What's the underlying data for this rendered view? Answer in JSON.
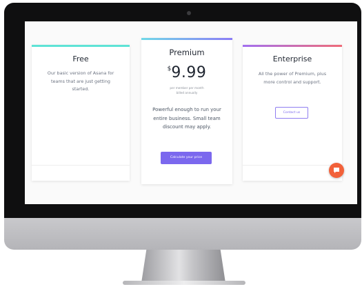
{
  "pricing": {
    "free": {
      "title": "Free",
      "description": "Our basic version of Asana for teams that are just getting started."
    },
    "premium": {
      "title": "Premium",
      "currency": "$",
      "price": "9.99",
      "note_line1": "per member per month",
      "note_line2": "billed annually",
      "description": "Powerful enough to run your entire business. Small team discount may apply.",
      "button_label": "Calculate your price"
    },
    "enterprise": {
      "title": "Enterprise",
      "description": "All the power of Premium, plus more control and support.",
      "button_label": "Contact us"
    }
  },
  "colors": {
    "free_bar": "#5ee3d6",
    "premium_bar": "#8b7cf6",
    "enterprise_bar_start": "#a26ff0",
    "enterprise_bar_end": "#ef6b78",
    "primary_button": "#7b68ee",
    "chat_bubble": "#f2613a"
  },
  "icons": {
    "chat": "chat-icon",
    "camera": "camera-icon"
  }
}
